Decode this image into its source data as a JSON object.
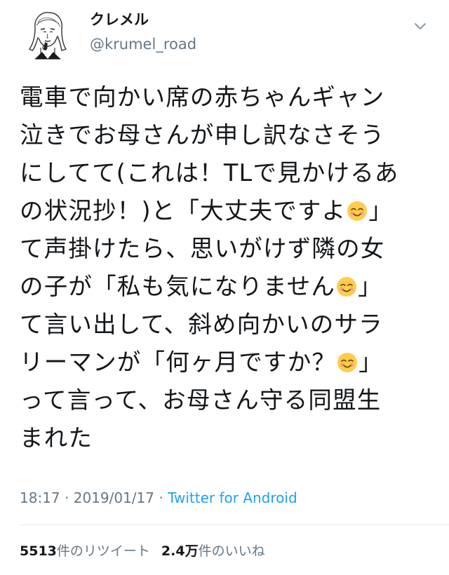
{
  "user": {
    "display_name": "クレメル",
    "handle": "@krumel_road"
  },
  "tweet": {
    "lines": [
      {
        "text": "電車で向かい席の赤ちゃんギャン",
        "emoji": false,
        "suffix": ""
      },
      {
        "text": "泣きでお母さんが申し訳なさそう",
        "emoji": false,
        "suffix": ""
      },
      {
        "text": "にしてて(これは！TLで見かけるあ",
        "emoji": false,
        "suffix": ""
      },
      {
        "text": "の状況抄！)と「大丈夫ですよ",
        "emoji": true,
        "suffix": "」"
      },
      {
        "text": "て声掛けたら、思いがけず隣の女",
        "emoji": false,
        "suffix": ""
      },
      {
        "text": "の子が「私も気になりません",
        "emoji": true,
        "suffix": "」"
      },
      {
        "text": "て言い出して、斜め向かいのサラ",
        "emoji": false,
        "suffix": ""
      },
      {
        "text": "リーマンが「何ヶ月ですか？",
        "emoji": true,
        "suffix": "」"
      },
      {
        "text": "って言って、お母さん守る同盟生",
        "emoji": false,
        "suffix": ""
      },
      {
        "text": "まれた",
        "emoji": false,
        "suffix": ""
      }
    ],
    "emoji_name": "smiling-face-icon"
  },
  "meta": {
    "time": "18:17",
    "separator1": " · ",
    "date": "2019/01/17",
    "separator2": " · ",
    "source": "Twitter for Android"
  },
  "stats": {
    "retweets_count": "5513",
    "retweets_label": "件のリツイート",
    "likes_count": "2.4万",
    "likes_label": "件のいいね"
  },
  "colors": {
    "text": "#14171a",
    "secondary": "#657786",
    "link": "#1da1f2",
    "divider": "#e1e8ed"
  }
}
